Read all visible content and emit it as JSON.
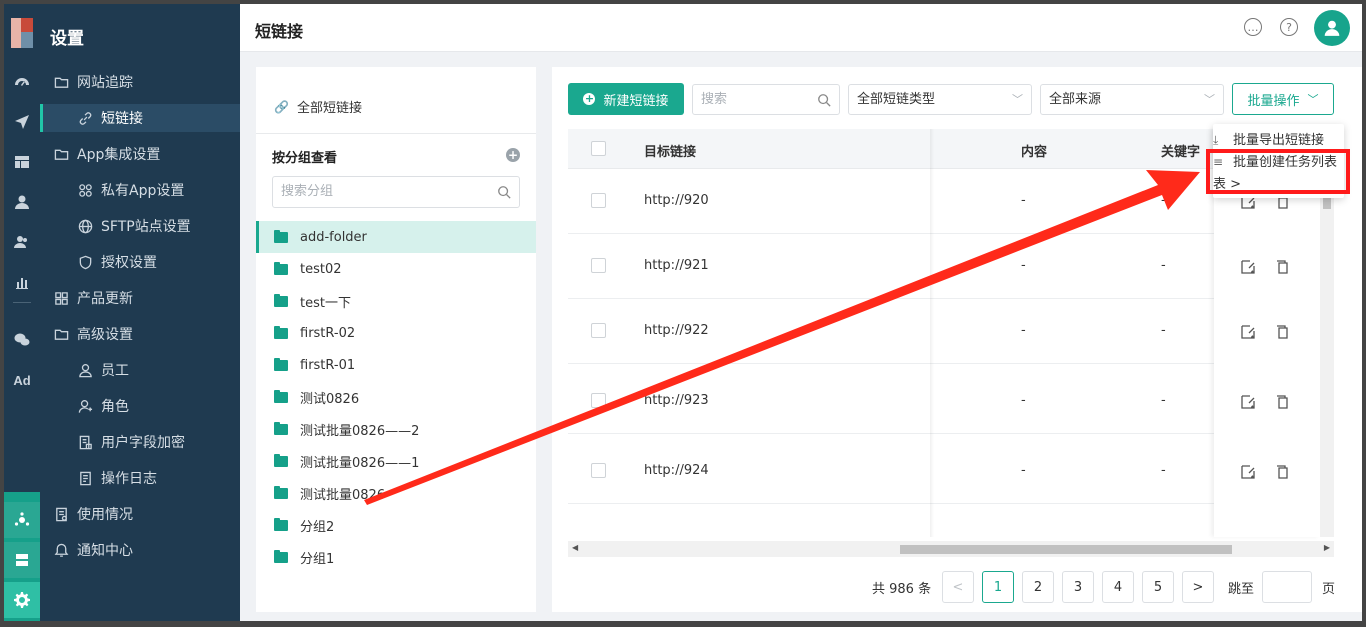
{
  "menu": {
    "title": "设置",
    "items": [
      {
        "label": "网站追踪"
      },
      {
        "label": "短链接"
      },
      {
        "label": "App集成设置"
      },
      {
        "label": "私有App设置"
      },
      {
        "label": "SFTP站点设置"
      },
      {
        "label": "授权设置"
      },
      {
        "label": "产品更新"
      },
      {
        "label": "高级设置"
      },
      {
        "label": "员工"
      },
      {
        "label": "角色"
      },
      {
        "label": "用户字段加密"
      },
      {
        "label": "操作日志"
      },
      {
        "label": "使用情况"
      },
      {
        "label": "通知中心"
      }
    ]
  },
  "rail": {
    "ad_label": "Ad"
  },
  "header": {
    "title": "短链接"
  },
  "groups": {
    "all_label": "全部短链接",
    "heading": "按分组查看",
    "add_symbol": "+",
    "search_placeholder": "搜索分组",
    "items": [
      {
        "label": "add-folder"
      },
      {
        "label": "test02"
      },
      {
        "label": "test一下"
      },
      {
        "label": "firstR-02"
      },
      {
        "label": "firstR-01"
      },
      {
        "label": "测试0826"
      },
      {
        "label": "测试批量0826——2"
      },
      {
        "label": "测试批量0826——1"
      },
      {
        "label": "测试批量0826"
      },
      {
        "label": "分组2"
      },
      {
        "label": "分组1"
      }
    ]
  },
  "toolbar": {
    "new_label": "新建短链接",
    "search_placeholder": "搜索",
    "type_select": "全部短链类型",
    "source_select": "全部来源",
    "batch_label": "批量操作"
  },
  "dropdown": {
    "items": [
      {
        "label": "批量导出短链接"
      },
      {
        "label": "批量创建任务列表"
      }
    ],
    "more": "表 >"
  },
  "table": {
    "columns": [
      "目标链接",
      "内容",
      "关键字"
    ],
    "rows": [
      {
        "url": "http://920",
        "content": "-",
        "keyword": "-"
      },
      {
        "url": "http://921",
        "content": "-",
        "keyword": "-"
      },
      {
        "url": "http://922",
        "content": "-",
        "keyword": "-"
      },
      {
        "url": "http://923",
        "content": "-",
        "keyword": "-"
      },
      {
        "url": "http://924",
        "content": "-",
        "keyword": "-"
      }
    ]
  },
  "pagination": {
    "total": "共 986 条",
    "prev": "<",
    "next": ">",
    "pages": [
      "1",
      "2",
      "3",
      "4",
      "5"
    ],
    "current": "1",
    "goto_label": "跳至",
    "page_suffix": "页"
  },
  "colors": {
    "accent": "#1aa88f",
    "sidebar": "#1f3a50",
    "annotation": "#ff1a1a"
  }
}
